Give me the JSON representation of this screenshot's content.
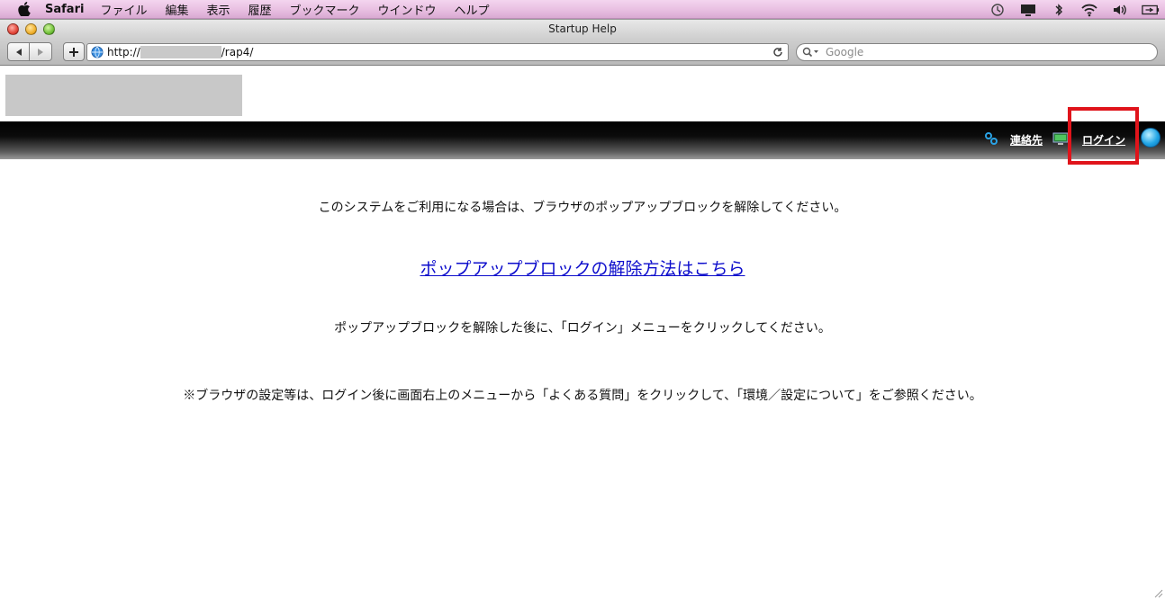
{
  "menubar": {
    "app_name": "Safari",
    "items": [
      "ファイル",
      "編集",
      "表示",
      "履歴",
      "ブックマーク",
      "ウインドウ",
      "ヘルプ"
    ]
  },
  "window": {
    "title": "Startup Help"
  },
  "toolbar": {
    "url_prefix": "http://",
    "url_suffix": "/rap4/",
    "search_placeholder": "Google"
  },
  "page": {
    "header": {
      "contacts_label": "連絡先",
      "login_label": "ログイン"
    },
    "message1": "このシステムをご利用になる場合は、ブラウザのポップアップブロックを解除してください。",
    "help_link": "ポップアップブロックの解除方法はこちら",
    "message2": "ポップアップブロックを解除した後に、「ログイン」メニューをクリックしてください。",
    "message3": "※ブラウザの設定等は、ログイン後に画面右上のメニューから「よくある質問」をクリックして、「環境／設定について」をご参照ください。"
  },
  "colors": {
    "highlight": "#e0141b",
    "link": "#0d0dcc",
    "menubar_bg": "#e7bde0"
  }
}
